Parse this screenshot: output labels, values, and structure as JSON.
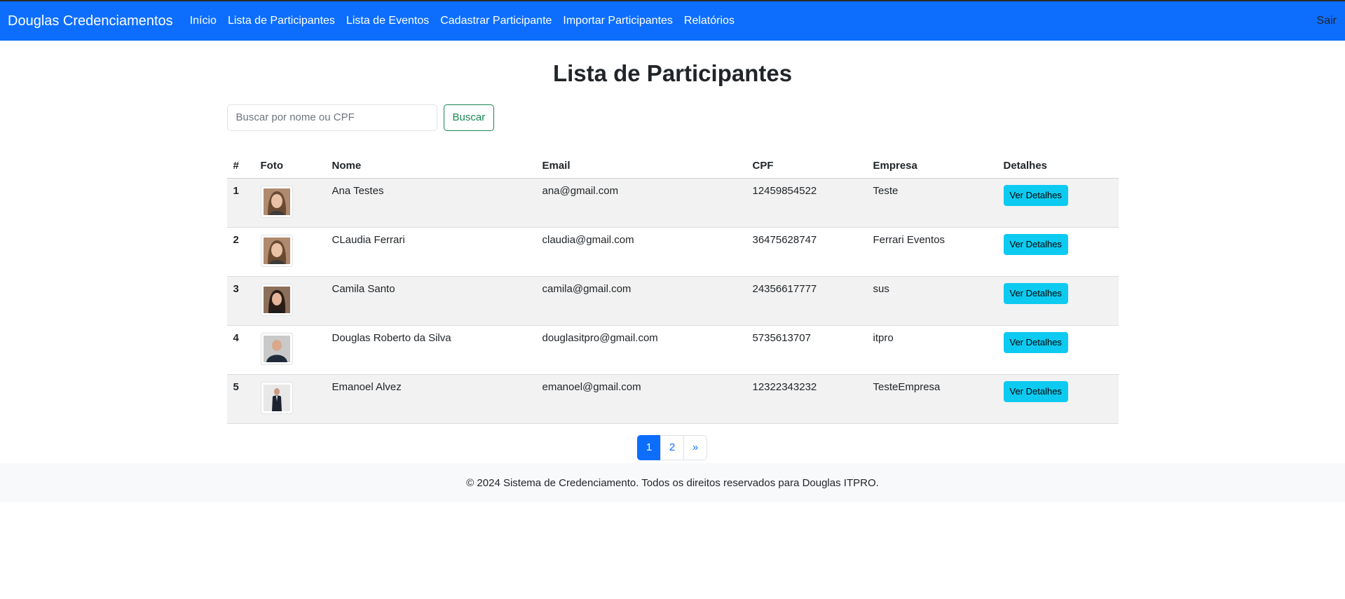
{
  "navbar": {
    "brand": "Douglas Credenciamentos",
    "links": [
      "Início",
      "Lista de Participantes",
      "Lista de Eventos",
      "Cadastrar Participante",
      "Importar Participantes",
      "Relatórios"
    ],
    "logout": "Sair",
    "color": "#0d6efd"
  },
  "page": {
    "title": "Lista de Participantes"
  },
  "search": {
    "placeholder": "Buscar por nome ou CPF",
    "value": "",
    "button": "Buscar"
  },
  "table": {
    "headers": [
      "#",
      "Foto",
      "Nome",
      "Email",
      "CPF",
      "Empresa",
      "Detalhes"
    ],
    "rows": [
      {
        "num": "1",
        "photo": "participant-photo",
        "name": "Ana Testes",
        "email": "ana@gmail.com",
        "cpf": "12459854522",
        "company": "Teste",
        "action": "Ver Detalhes"
      },
      {
        "num": "2",
        "photo": "participant-photo",
        "name": "CLaudia Ferrari",
        "email": "claudia@gmail.com",
        "cpf": "36475628747",
        "company": "Ferrari Eventos",
        "action": "Ver Detalhes"
      },
      {
        "num": "3",
        "photo": "participant-photo",
        "name": "Camila Santo",
        "email": "camila@gmail.com",
        "cpf": "24356617777",
        "company": "sus",
        "action": "Ver Detalhes"
      },
      {
        "num": "4",
        "photo": "participant-photo",
        "name": "Douglas Roberto da Silva",
        "email": "douglasitpro@gmail.com",
        "cpf": "5735613707",
        "company": "itpro",
        "action": "Ver Detalhes"
      },
      {
        "num": "5",
        "photo": "participant-photo",
        "name": "Emanoel Alvez",
        "email": "emanoel@gmail.com",
        "cpf": "12322343232",
        "company": "TesteEmpresa",
        "action": "Ver Detalhes"
      }
    ]
  },
  "pagination": {
    "pages": [
      "1",
      "2"
    ],
    "active": "1",
    "next": "»"
  },
  "footer": {
    "text": "© 2024 Sistema de Credenciamento. Todos os direitos reservados para Douglas ITPRO."
  }
}
